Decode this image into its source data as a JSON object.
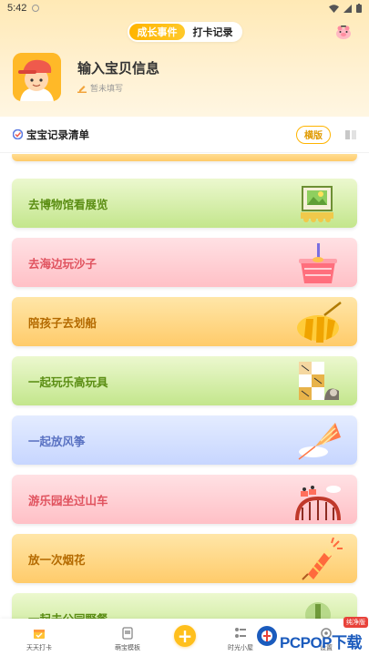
{
  "status_bar": {
    "time": "5:42"
  },
  "tabs": [
    {
      "label": "成长事件",
      "active": true
    },
    {
      "label": "打卡记录",
      "active": false
    }
  ],
  "profile": {
    "title": "输入宝贝信息",
    "subtitle": "暂未填写"
  },
  "list_header": {
    "label": "宝宝记录清单",
    "mode_button": "横版"
  },
  "cards": [
    {
      "label": "去博物馆看展览",
      "theme": "green",
      "icon": "museum-picture-icon"
    },
    {
      "label": "去海边玩沙子",
      "theme": "pink",
      "icon": "sand-bucket-icon"
    },
    {
      "label": "陪孩子去划船",
      "theme": "orange",
      "icon": "boat-icon"
    },
    {
      "label": "一起玩乐高玩具",
      "theme": "green",
      "icon": "lego-blocks-icon"
    },
    {
      "label": "一起放风筝",
      "theme": "blue",
      "icon": "kite-icon"
    },
    {
      "label": "游乐园坐过山车",
      "theme": "pink",
      "icon": "roller-coaster-icon"
    },
    {
      "label": "放一次烟花",
      "theme": "orange",
      "icon": "firework-icon"
    },
    {
      "label": "一起去公园野餐",
      "theme": "green",
      "icon": "picnic-icon"
    }
  ],
  "bottom_nav": [
    {
      "label": "天天打卡",
      "icon": "calendar-check-icon"
    },
    {
      "label": "萌宝模板",
      "icon": "template-icon"
    },
    {
      "label": "",
      "icon": "plus-icon"
    },
    {
      "label": "时光小屋",
      "icon": "timeline-icon"
    },
    {
      "label": "设置",
      "icon": "settings-icon"
    }
  ],
  "watermark": {
    "text": "PCPOP下载",
    "badge": "纯净版"
  },
  "colors": {
    "accent": "#ffb400",
    "green_text": "#5b8e14",
    "pink_text": "#e0525e",
    "orange_text": "#b46a00",
    "blue_text": "#5a72c2"
  }
}
